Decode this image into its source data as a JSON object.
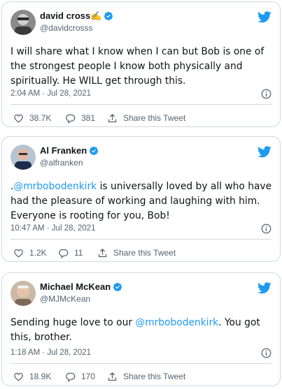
{
  "colors": {
    "accent": "#1d9bf0",
    "text": "#0f1419",
    "muted": "#536471",
    "border": "#cfd9de"
  },
  "tweets": [
    {
      "name": "david cross✍️",
      "handle": "@davidcrosss",
      "verified": true,
      "text_parts": [
        "I will share what I know when I can but Bob is one of the strongest people I know both physically and spiritually. He WILL get through this."
      ],
      "timestamp": "2:04 AM · Jul 28, 2021",
      "likes": "38.7K",
      "replies": "381",
      "share_label": "Share this Tweet"
    },
    {
      "name": "Al Franken",
      "handle": "@alfranken",
      "verified": true,
      "text_prefix": ".",
      "mention": "@mrbobodenkirk",
      "text_suffix": " is universally loved by all who have had the pleasure of working and laughing with him. Everyone is rooting for you, Bob!",
      "timestamp": "10:47 AM · Jul 28, 2021",
      "likes": "1.2K",
      "replies": "11",
      "share_label": "Share this Tweet"
    },
    {
      "name": "Michael McKean",
      "handle": "@MJMcKean",
      "verified": true,
      "text_prefix": "Sending huge love to our ",
      "mention": "@mrbobodenkirk",
      "text_suffix": ". You got this, brother.",
      "timestamp": "1:18 AM · Jul 28, 2021",
      "likes": "18.9K",
      "replies": "170",
      "share_label": "Share this Tweet"
    }
  ]
}
